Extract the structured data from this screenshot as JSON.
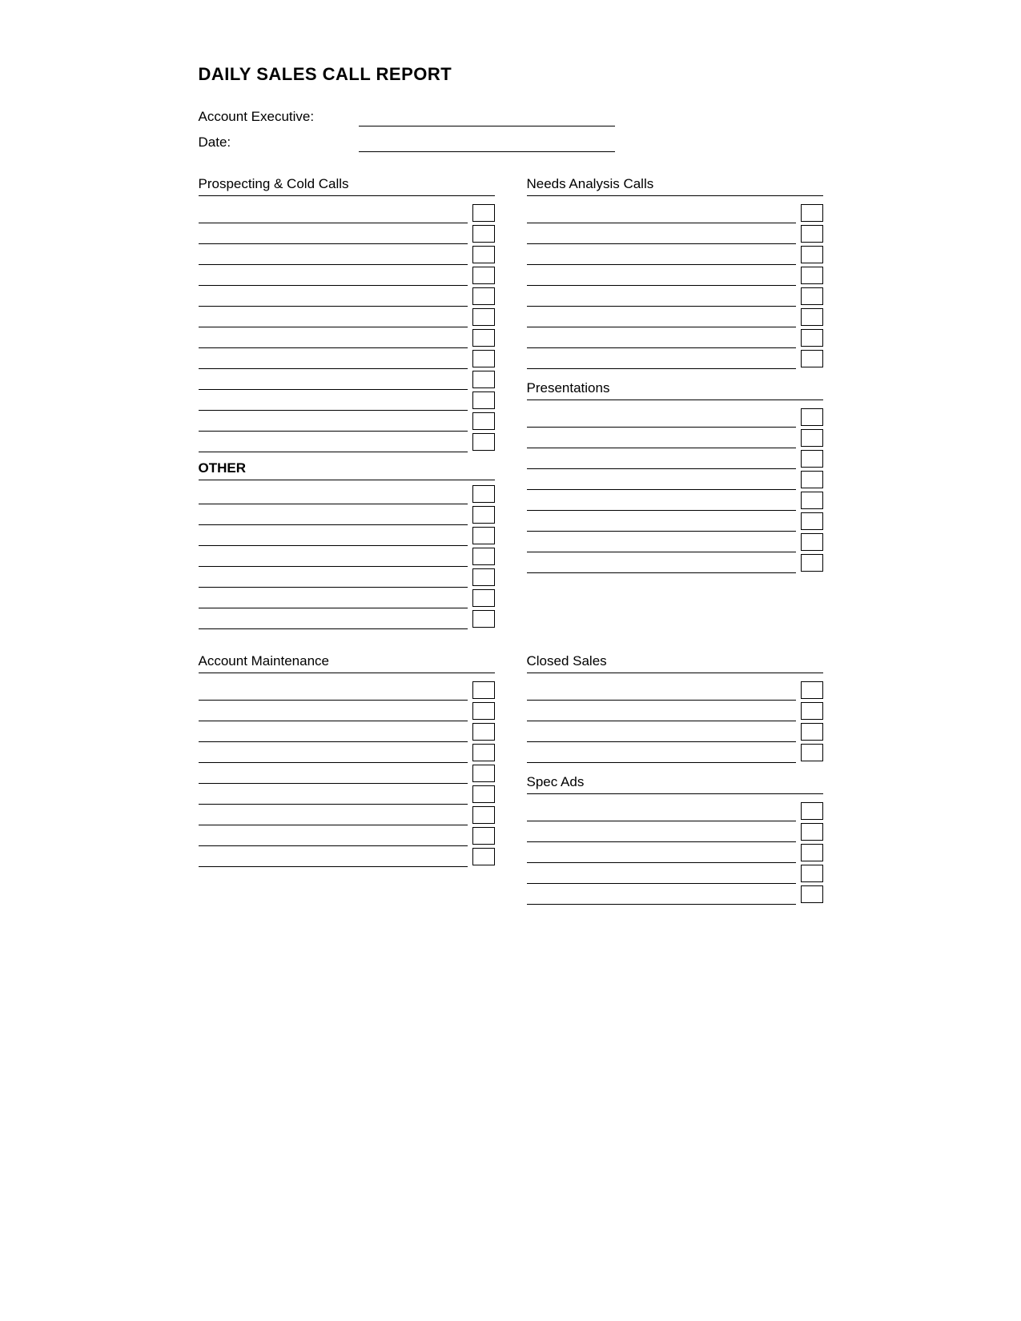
{
  "title": "DAILY SALES CALL REPORT",
  "header": {
    "account_executive_label": "Account Executive:",
    "date_label": "Date:"
  },
  "sections": {
    "prospecting_cold_calls": {
      "title": "Prospecting & Cold Calls",
      "rows": 12
    },
    "needs_analysis_calls": {
      "title": "Needs Analysis Calls",
      "rows": 8
    },
    "other": {
      "title": "OTHER",
      "rows": 7
    },
    "presentations": {
      "title": "Presentations",
      "rows": 8
    },
    "account_maintenance": {
      "title": "Account Maintenance",
      "rows": 9
    },
    "closed_sales": {
      "title": "Closed Sales",
      "rows": 4
    },
    "spec_ads": {
      "title": "Spec Ads",
      "rows": 5
    }
  }
}
